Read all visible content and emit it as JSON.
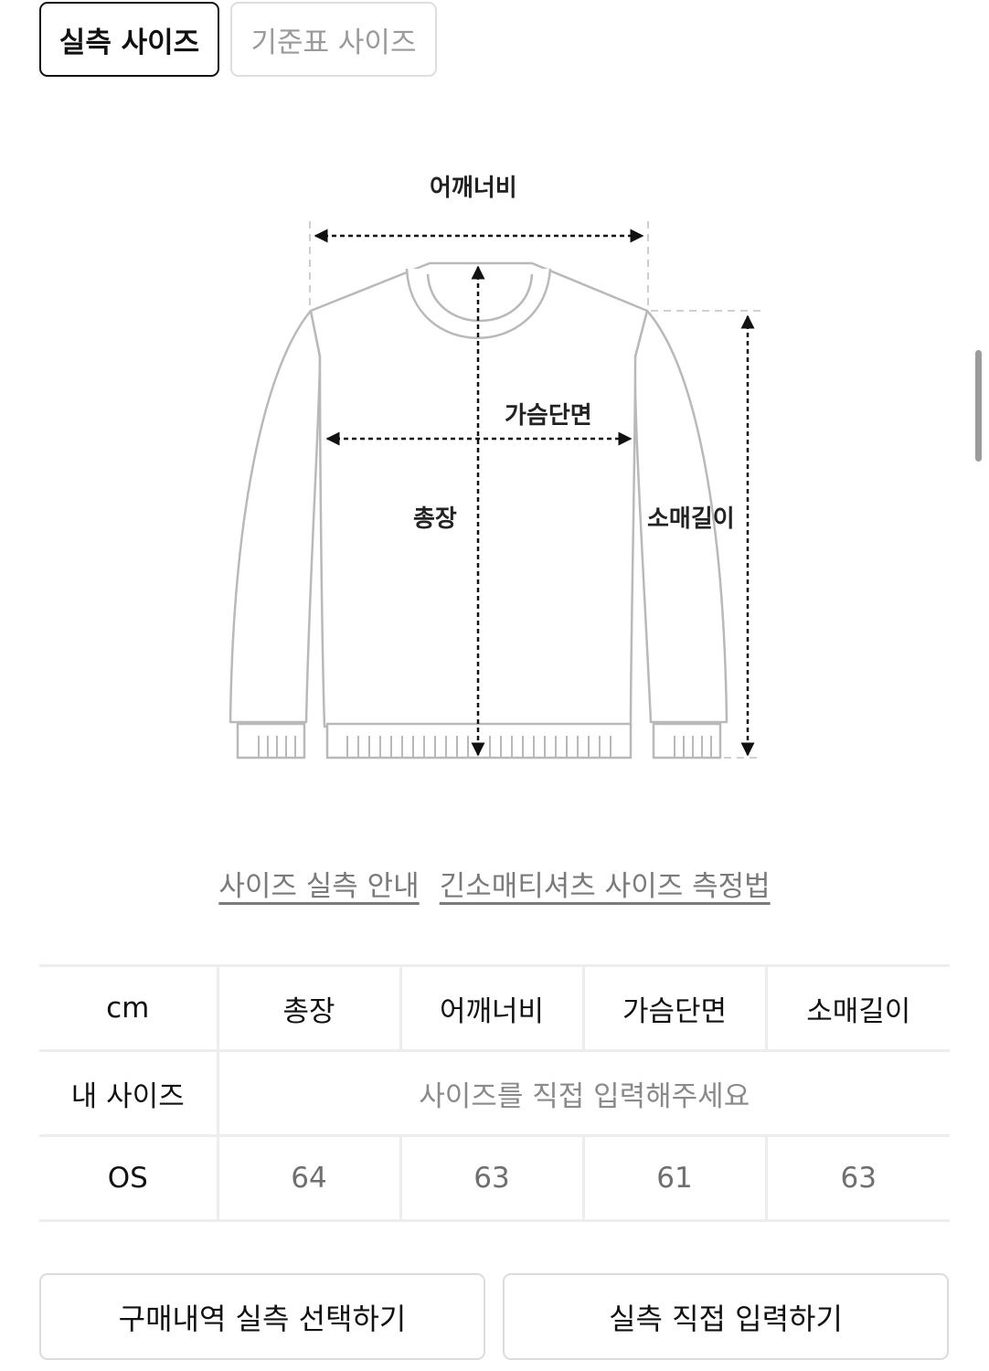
{
  "tabs": {
    "active": "실측 사이즈",
    "inactive": "기준표 사이즈"
  },
  "diagram": {
    "shoulder": "어깨너비",
    "chest": "가슴단면",
    "length": "총장",
    "sleeve": "소매길이"
  },
  "links": {
    "guide": "사이즈 실측 안내",
    "method": "긴소매티셔츠 사이즈 측정법"
  },
  "table": {
    "unit": "cm",
    "columns": [
      "총장",
      "어깨너비",
      "가슴단면",
      "소매길이"
    ],
    "my_size_label": "내 사이즈",
    "my_size_placeholder": "사이즈를 직접 입력해주세요",
    "rows": [
      {
        "size": "OS",
        "values": [
          "64",
          "63",
          "61",
          "63"
        ]
      }
    ]
  },
  "buttons": {
    "purchase": "구매내역 실측 선택하기",
    "direct": "실측 직접 입력하기"
  },
  "colors": {
    "accent": "#111111",
    "muted_text": "#8a8a8a",
    "border": "#ededed"
  }
}
